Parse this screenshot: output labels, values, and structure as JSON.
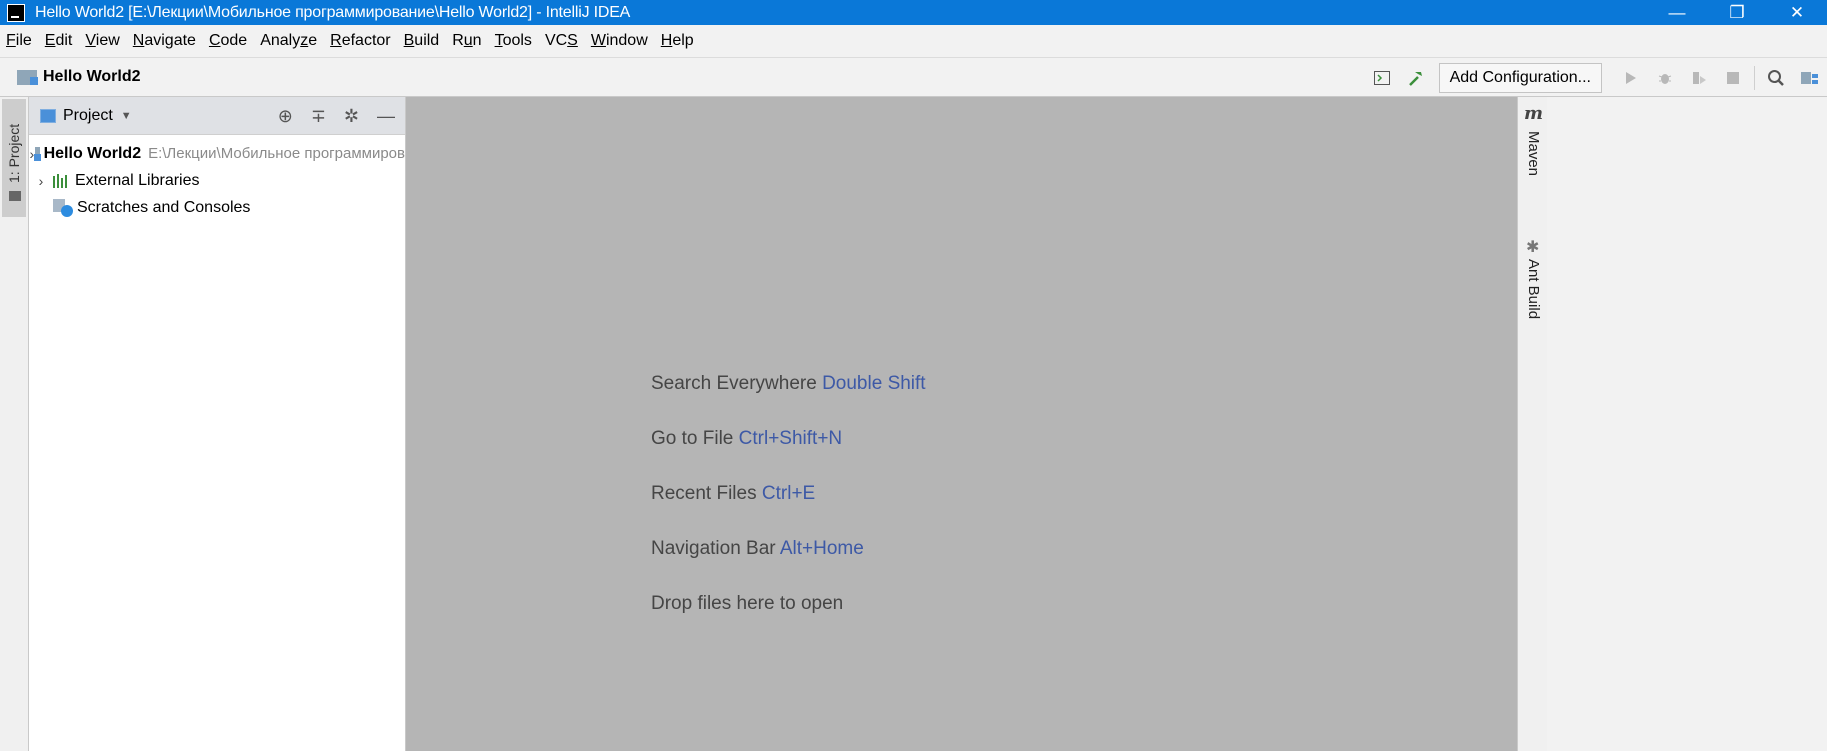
{
  "window": {
    "title": "Hello World2 [E:\\Лекции\\Мобильное программирование\\Hello World2] - IntelliJ IDEA",
    "controls": {
      "minimize": "—",
      "maximize": "❐",
      "close": "✕"
    }
  },
  "menu": [
    {
      "label": "File",
      "mnemonic": "F",
      "rest": "ile"
    },
    {
      "label": "Edit",
      "mnemonic": "E",
      "rest": "dit"
    },
    {
      "label": "View",
      "mnemonic": "V",
      "rest": "iew"
    },
    {
      "label": "Navigate",
      "mnemonic": "N",
      "rest": "avigate"
    },
    {
      "label": "Code",
      "mnemonic": "C",
      "rest": "ode"
    },
    {
      "label": "Analyze",
      "prefix": "Analy",
      "mnemonic": "z",
      "rest": "e"
    },
    {
      "label": "Refactor",
      "mnemonic": "R",
      "rest": "efactor"
    },
    {
      "label": "Build",
      "mnemonic": "B",
      "rest": "uild"
    },
    {
      "label": "Run",
      "prefix": "R",
      "mnemonic": "u",
      "rest": "n"
    },
    {
      "label": "Tools",
      "mnemonic": "T",
      "rest": "ools"
    },
    {
      "label": "VCS",
      "prefix": "VC",
      "mnemonic": "S",
      "rest": ""
    },
    {
      "label": "Window",
      "mnemonic": "W",
      "rest": "indow"
    },
    {
      "label": "Help",
      "mnemonic": "H",
      "rest": "elp"
    }
  ],
  "navbar": {
    "project_name": "Hello World2",
    "add_configuration": "Add Configuration..."
  },
  "left_stripe": {
    "project_tab": "1: Project"
  },
  "project_panel": {
    "title": "Project",
    "tree": [
      {
        "label": "Hello World2",
        "path": "E:\\Лекции\\Мобильное программиров"
      },
      {
        "label": "External Libraries"
      },
      {
        "label": "Scratches and Consoles"
      }
    ]
  },
  "editor_hints": [
    {
      "text": "Search Everywhere",
      "shortcut": "Double Shift"
    },
    {
      "text": "Go to File",
      "shortcut": "Ctrl+Shift+N"
    },
    {
      "text": "Recent Files",
      "shortcut": "Ctrl+E"
    },
    {
      "text": "Navigation Bar",
      "shortcut": "Alt+Home"
    },
    {
      "text": "Drop files here to open",
      "shortcut": ""
    }
  ],
  "right_stripe": {
    "maven": "Maven",
    "ant": "Ant Build"
  },
  "colors": {
    "titlebar": "#0a78d8",
    "editor_bg": "#b5b5b5",
    "shortcut": "#3d59a6"
  }
}
